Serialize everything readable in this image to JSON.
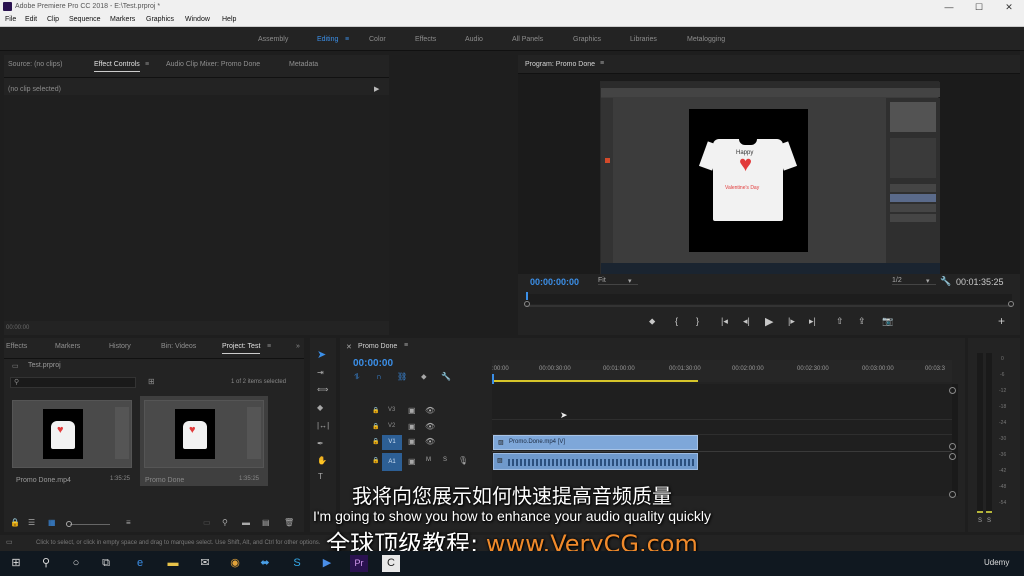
{
  "window": {
    "title": "Adobe Premiere Pro CC 2018 - E:\\Test.prproj *",
    "min": "—",
    "max": "☐",
    "close": "✕"
  },
  "menu": [
    "File",
    "Edit",
    "Clip",
    "Sequence",
    "Markers",
    "Graphics",
    "Window",
    "Help"
  ],
  "workspaces": {
    "items": [
      "Assembly",
      "Editing",
      "Color",
      "Effects",
      "Audio",
      "All Panels",
      "Graphics",
      "Libraries",
      "Metalogging"
    ],
    "active": "Editing",
    "menu_icon": "≡"
  },
  "source_panel": {
    "tabs": [
      "Source: (no clips)",
      "Effect Controls",
      "Audio Clip Mixer: Promo Done",
      "Metadata"
    ],
    "active_tab": "Effect Controls",
    "menu_icon": "≡",
    "no_clip": "(no clip selected)",
    "timecode": "00:00:00"
  },
  "program_monitor": {
    "title": "Program: Promo Done",
    "menu_icon": "≡",
    "timecode": "00:00:00:00",
    "fit": "Fit",
    "fraction": "1/2",
    "duration": "00:01:35:25",
    "shirt_text_top": "Happy",
    "shirt_text_bottom": "Valentine's Day"
  },
  "bottom_left": {
    "tabs": [
      "Effects",
      "Markers",
      "History",
      "Bin: Videos",
      "Project: Test"
    ],
    "active_tab": "Project: Test",
    "menu_icon": "≡",
    "more_icon": "»",
    "project_file": "Test.prproj",
    "items_selected": "1 of 2 items selected",
    "items": [
      {
        "name": "Promo Done.mp4",
        "duration": "1:35:25"
      },
      {
        "name": "Promo Done",
        "duration": "1:35:25"
      }
    ]
  },
  "timeline": {
    "title": "Promo Done",
    "menu_icon": "≡",
    "close_icon": "✕",
    "timecode": "00:00:00",
    "ruler": [
      ":00:00",
      "00:00:30:00",
      "00:01:00:00",
      "00:01:30:00",
      "00:02:00:00",
      "00:02:30:00",
      "00:03:00:00",
      "00:03:3"
    ],
    "tracks_video": [
      "V3",
      "V2",
      "V1"
    ],
    "tracks_audio": [
      "A1"
    ],
    "video_clip": "Promo.Done.mp4 [V]",
    "mute": "M",
    "solo": "S"
  },
  "meter": {
    "scale": [
      "0",
      "-6",
      "-12",
      "-18",
      "-24",
      "-30",
      "-36",
      "-42",
      "-48",
      "-54"
    ],
    "solo_l": "S",
    "solo_r": "S"
  },
  "status": "Click to select, or click in empty space and drag to marquee select. Use Shift, Alt, and Ctrl for other options.",
  "subtitles": {
    "cn": "我将向您展示如何快速提高音频质量",
    "en": "I'm going to show you how to enhance your audio quality quickly",
    "promo_prefix": "全球顶级教程:",
    "promo_url": "www.VeryCG.com"
  },
  "taskbar": {
    "udemy": "Udemy"
  },
  "colors": {
    "accent": "#3b8fe8",
    "clip_video": "#7ea7d9",
    "clip_audio": "#6f99cc",
    "orange": "#f08a2b"
  }
}
